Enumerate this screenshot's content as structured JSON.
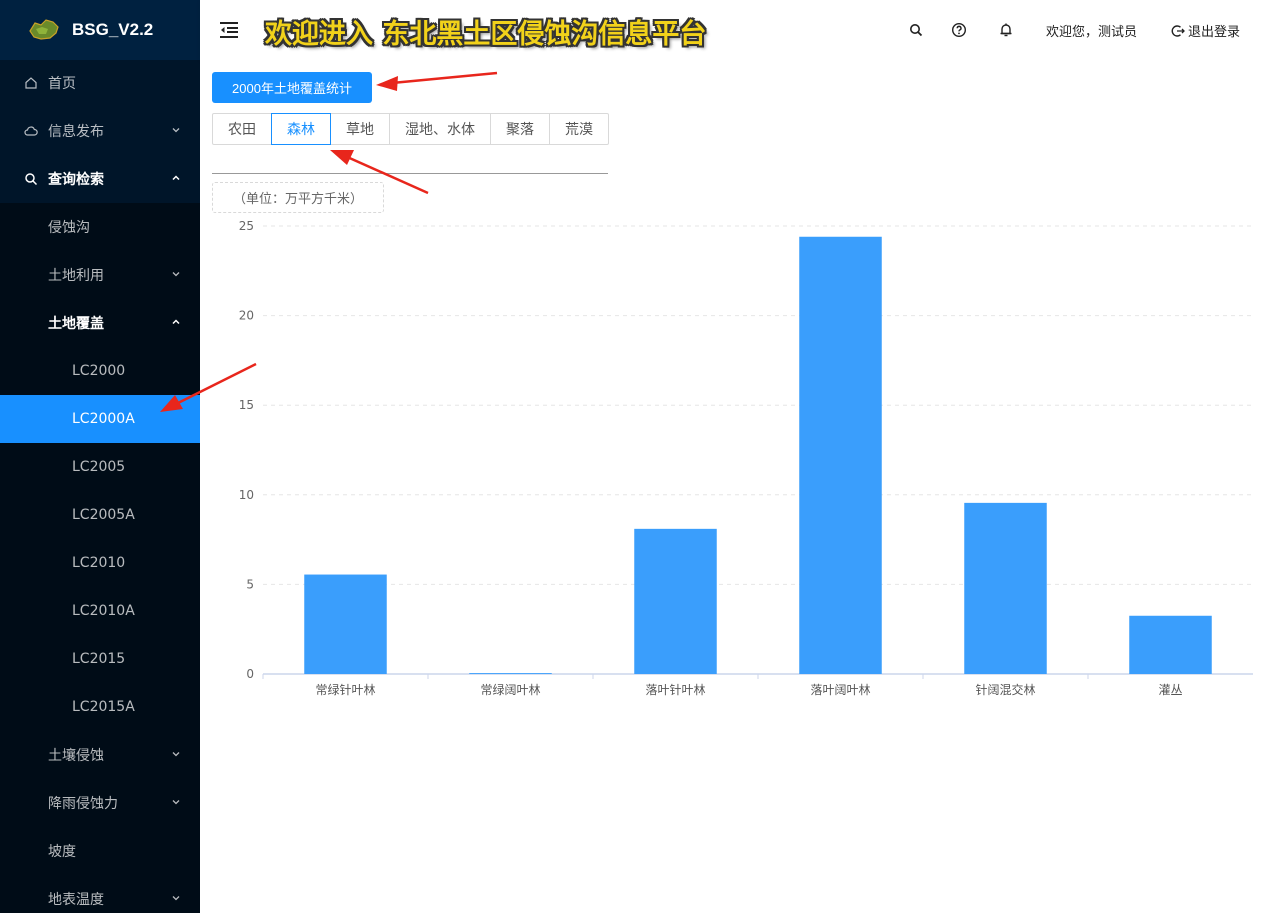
{
  "app": {
    "logo_text": "BSG_V2.2"
  },
  "sidebar": {
    "items": [
      {
        "label": "首页"
      },
      {
        "label": "信息发布"
      },
      {
        "label": "查询检索"
      },
      {
        "label": "侵蚀沟"
      },
      {
        "label": "土地利用"
      },
      {
        "label": "土地覆盖"
      },
      {
        "label": "LC2000"
      },
      {
        "label": "LC2000A"
      },
      {
        "label": "LC2005"
      },
      {
        "label": "LC2005A"
      },
      {
        "label": "LC2010"
      },
      {
        "label": "LC2010A"
      },
      {
        "label": "LC2015"
      },
      {
        "label": "LC2015A"
      },
      {
        "label": "土壤侵蚀"
      },
      {
        "label": "降雨侵蚀力"
      },
      {
        "label": "坡度"
      },
      {
        "label": "地表温度"
      }
    ]
  },
  "header": {
    "banner": "欢迎进入 东北黑土区侵蚀沟信息平台",
    "welcome": "欢迎您，测试员",
    "logout": "退出登录"
  },
  "main": {
    "stats_button": "2000年土地覆盖统计",
    "tabs": [
      {
        "label": "农田"
      },
      {
        "label": "森林"
      },
      {
        "label": "草地"
      },
      {
        "label": "湿地、水体"
      },
      {
        "label": "聚落"
      },
      {
        "label": "荒漠"
      }
    ],
    "active_tab": "森林",
    "unit": "（单位：万平方千米）"
  },
  "colors": {
    "accent": "#1890ff",
    "bar": "#3a9efc",
    "sidebar_bg": "#001529",
    "banner": "#f2d21a"
  },
  "chart_data": {
    "type": "bar",
    "categories": [
      "常绿针叶林",
      "常绿阔叶林",
      "落叶针叶林",
      "落叶阔叶林",
      "针阔混交林",
      "灌丛"
    ],
    "values": [
      5.55,
      0.05,
      8.1,
      24.4,
      9.55,
      3.25
    ],
    "ylim": [
      0,
      25
    ],
    "yticks": [
      0,
      5,
      10,
      15,
      20,
      25
    ],
    "grid": true
  }
}
